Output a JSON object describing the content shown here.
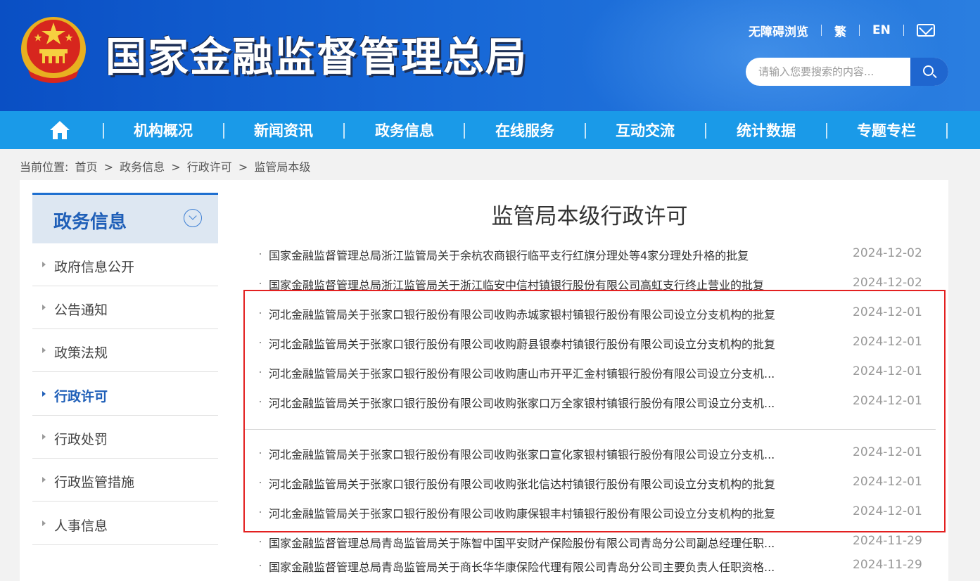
{
  "header": {
    "site_title": "国家金融监督管理总局",
    "top_links": [
      "无障碍浏览",
      "繁",
      "EN"
    ],
    "mail_icon": "mail-icon",
    "emblem_icon": "national-emblem-icon",
    "search": {
      "placeholder": "请输入您要搜索的内容..."
    }
  },
  "nav": {
    "home_icon": "home-icon",
    "items": [
      "机构概况",
      "新闻资讯",
      "政务信息",
      "在线服务",
      "互动交流",
      "统计数据",
      "专题专栏"
    ]
  },
  "breadcrumb": {
    "prefix": "当前位置:",
    "items": [
      "首页",
      "政务信息",
      "行政许可",
      "监管局本级"
    ],
    "separator": ">"
  },
  "sidebar": {
    "title": "政务信息",
    "items": [
      "政府信息公开",
      "公告通知",
      "政策法规",
      "行政许可",
      "行政处罚",
      "行政监管措施",
      "人事信息"
    ],
    "active_index": 3
  },
  "content": {
    "title": "监管局本级行政许可",
    "rows": [
      {
        "title": "国家金融监督管理总局浙江监管局关于余杭农商银行临平支行红旗分理处等4家分理处升格的批复",
        "date": "2024-12-02"
      },
      {
        "title": "国家金融监督管理总局浙江监管局关于浙江临安中信村镇银行股份有限公司高虹支行终止营业的批复",
        "date": "2024-12-02"
      },
      {
        "title": "河北金融监管局关于张家口银行股份有限公司收购赤城家银村镇银行股份有限公司设立分支机构的批复",
        "date": "2024-12-01"
      },
      {
        "title": "河北金融监管局关于张家口银行股份有限公司收购蔚县银泰村镇银行股份有限公司设立分支机构的批复",
        "date": "2024-12-01"
      },
      {
        "title": "河北金融监管局关于张家口银行股份有限公司收购唐山市开平汇金村镇银行股份有限公司设立分支机...",
        "date": "2024-12-01"
      },
      {
        "title": "河北金融监管局关于张家口银行股份有限公司收购张家口万全家银村镇银行股份有限公司设立分支机...",
        "date": "2024-12-01"
      },
      {
        "title": "河北金融监管局关于张家口银行股份有限公司收购张家口宣化家银村镇银行股份有限公司设立分支机...",
        "date": "2024-12-01"
      },
      {
        "title": "河北金融监管局关于张家口银行股份有限公司收购张北信达村镇银行股份有限公司设立分支机构的批复",
        "date": "2024-12-01"
      },
      {
        "title": "河北金融监管局关于张家口银行股份有限公司收购康保银丰村镇银行股份有限公司设立分支机构的批复",
        "date": "2024-12-01"
      },
      {
        "title": "国家金融监督管理总局青岛监管局关于陈智中国平安财产保险股份有限公司青岛分公司副总经理任职...",
        "date": "2024-11-29"
      },
      {
        "title": "国家金融监督管理总局青岛监管局关于商长华华康保险代理有限公司青岛分公司主要负责人任职资格...",
        "date": "2024-11-29"
      }
    ]
  },
  "colors": {
    "header_blue": "#1767d6",
    "nav_blue": "#1a9ae8",
    "highlight_red": "#e32020",
    "active_blue": "#1f5fb8"
  }
}
